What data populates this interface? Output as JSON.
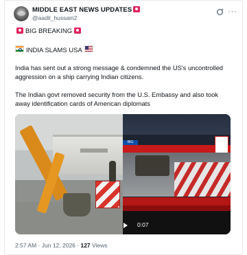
{
  "author": {
    "name": "MIDDLE EAST NEWS UPDATES",
    "handle": "@aadil_hussain2"
  },
  "post": {
    "headline": "BIG BREAKING",
    "subhead": "INDIA SLAMS USA",
    "paragraph1": "India has sent out a strong message & condemned the US's uncontrolled aggression on a ship carrying Indian citizens.",
    "paragraph2": "The Indian govt removed security from the U.S. Embassy and also took away identification cards of American diplomats"
  },
  "media": {
    "left_image": "bulldozer-at-embassy",
    "right_image": "news-broadcast-still",
    "news_tag": "BIG",
    "duration": "0:07"
  },
  "meta": {
    "time": "2:57 AM",
    "date": "Jun 12, 2026",
    "views_count": "127",
    "views_label": "Views"
  },
  "icons": {
    "grok": "grok-icon",
    "more": "more-options-icon",
    "siren": "siren-icon",
    "play": "play-icon"
  },
  "colors": {
    "text": "#0f1419",
    "secondary": "#536471",
    "alert_red": "#e0245e"
  }
}
